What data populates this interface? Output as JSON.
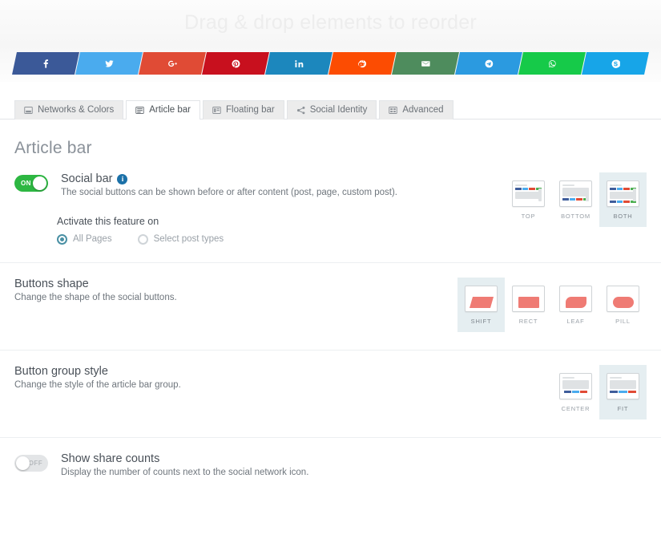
{
  "header": {
    "drag_hint": "Drag & drop elements to reorder"
  },
  "social_bar": {
    "buttons": [
      {
        "name": "facebook",
        "icon": "facebook-icon",
        "color": "#3b5998"
      },
      {
        "name": "twitter",
        "icon": "twitter-icon",
        "color": "#4aabee"
      },
      {
        "name": "googleplus",
        "icon": "google-plus-icon",
        "color": "#e04b35"
      },
      {
        "name": "pinterest",
        "icon": "pinterest-icon",
        "color": "#c8101e"
      },
      {
        "name": "linkedin",
        "icon": "linkedin-icon",
        "color": "#1c87bd"
      },
      {
        "name": "reddit",
        "icon": "reddit-icon",
        "color": "#fc4c02"
      },
      {
        "name": "email",
        "icon": "envelope-icon",
        "color": "#4e8c5d"
      },
      {
        "name": "telegram",
        "icon": "telegram-icon",
        "color": "#2b9ae0"
      },
      {
        "name": "whatsapp",
        "icon": "whatsapp-icon",
        "color": "#16ca49"
      },
      {
        "name": "skype",
        "icon": "skype-icon",
        "color": "#17a5e8"
      }
    ]
  },
  "tabs": [
    {
      "label": "Networks & Colors",
      "icon": "networks-icon",
      "active": false
    },
    {
      "label": "Article bar",
      "icon": "article-bar-icon",
      "active": true
    },
    {
      "label": "Floating bar",
      "icon": "floating-bar-icon",
      "active": false
    },
    {
      "label": "Social Identity",
      "icon": "share-nodes-icon",
      "active": false
    },
    {
      "label": "Advanced",
      "icon": "advanced-icon",
      "active": false
    }
  ],
  "page": {
    "title": "Article bar"
  },
  "social_bar_section": {
    "toggle": {
      "state": "ON",
      "on": true
    },
    "title": "Social bar",
    "info_glyph": "i",
    "description": "The social buttons can be shown before or after content (post, page, custom post).",
    "activate_label": "Activate this feature on",
    "radios": [
      {
        "label": "All Pages",
        "checked": true
      },
      {
        "label": "Select post types",
        "checked": false
      }
    ],
    "positions": [
      {
        "caption": "TOP",
        "selected": false
      },
      {
        "caption": "BOTTOM",
        "selected": false
      },
      {
        "caption": "BOTH",
        "selected": true
      }
    ]
  },
  "buttons_shape_section": {
    "title": "Buttons shape",
    "description": "Change the shape of the social buttons.",
    "shapes": [
      {
        "caption": "SHIFT",
        "shape": "shift",
        "selected": true
      },
      {
        "caption": "RECT",
        "shape": "rect",
        "selected": false
      },
      {
        "caption": "LEAF",
        "shape": "leaf",
        "selected": false
      },
      {
        "caption": "PILL",
        "shape": "pill",
        "selected": false
      }
    ]
  },
  "button_group_section": {
    "title": "Button group style",
    "description": "Change the style of the article bar group.",
    "styles": [
      {
        "caption": "CENTER",
        "selected": false
      },
      {
        "caption": "FIT",
        "selected": true
      }
    ]
  },
  "share_counts_section": {
    "toggle": {
      "state": "OFF",
      "on": false
    },
    "title": "Show share counts",
    "description": "Display the number of counts next to the social network icon."
  },
  "colors": {
    "accent_selected": "#e5eef1",
    "toggle_on": "#2db742",
    "toggle_off": "#e3e5e7",
    "shape_swatch": "#ef7b74",
    "info_blue": "#1c71a8"
  }
}
